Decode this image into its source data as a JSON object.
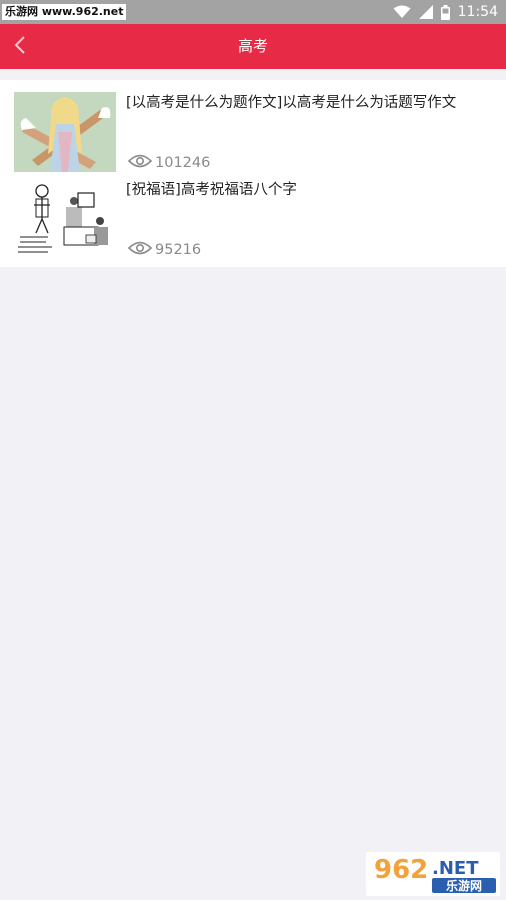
{
  "status_bar": {
    "watermark": "乐游网 www.962.net",
    "time": "11:54"
  },
  "header": {
    "title": "高考"
  },
  "articles": [
    {
      "title": "[以高考是什么为题作文]以高考是什么为话题写作文",
      "views": "101246"
    },
    {
      "title": "[祝福语]高考祝福语八个字",
      "views": "95216"
    }
  ],
  "watermark_logo": "962.NET 乐游网",
  "colors": {
    "app_bar": "#e72a45",
    "background": "#f2f1f6",
    "status_bar": "#a3a3a3"
  }
}
